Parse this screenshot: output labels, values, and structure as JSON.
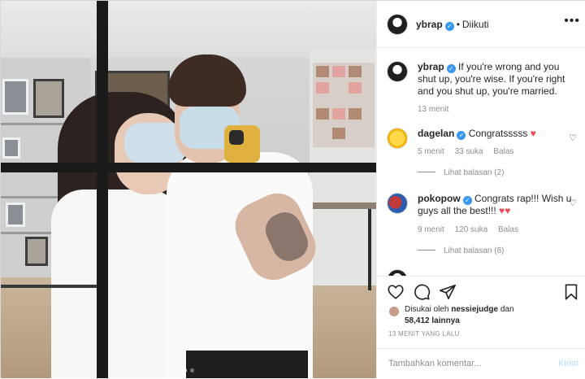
{
  "post": {
    "author": "ybrap",
    "follow_status": "Diikuti",
    "caption": "If you're wrong and you shut up, you're wise. If you're right and you shut up, you're married.",
    "caption_time": "13 menit"
  },
  "comments": [
    {
      "user": "dagelan",
      "text": "Congratsssss",
      "time": "5 menit",
      "likes": "33 suka",
      "reply_label": "Balas",
      "view_replies": "Lihat balasan (2)"
    },
    {
      "user": "pokopow",
      "text": "Congrats rap!!! Wish u guys all the best!!!",
      "time": "9 menit",
      "likes": "120 suka",
      "reply_label": "Balas",
      "view_replies": "Lihat balasan (8)"
    }
  ],
  "engagement": {
    "liked_by_prefix": "Disukai oleh",
    "liked_by_user": "nessiejudge",
    "liked_by_connector": "dan",
    "others_count": "58,412 lainnya",
    "posted_ago": "13 MENIT YANG LALU"
  },
  "composer": {
    "placeholder": "Tambahkan komentar...",
    "post_label": "Kirim"
  },
  "icons": [
    "more-icon",
    "heart-icon",
    "comment-icon",
    "share-icon",
    "bookmark-icon",
    "verified-icon"
  ],
  "colors": {
    "verified": "#3897f0",
    "link_disabled": "#b2dffc",
    "heart_red": "#ed4956",
    "muted": "#8e8e8e"
  }
}
